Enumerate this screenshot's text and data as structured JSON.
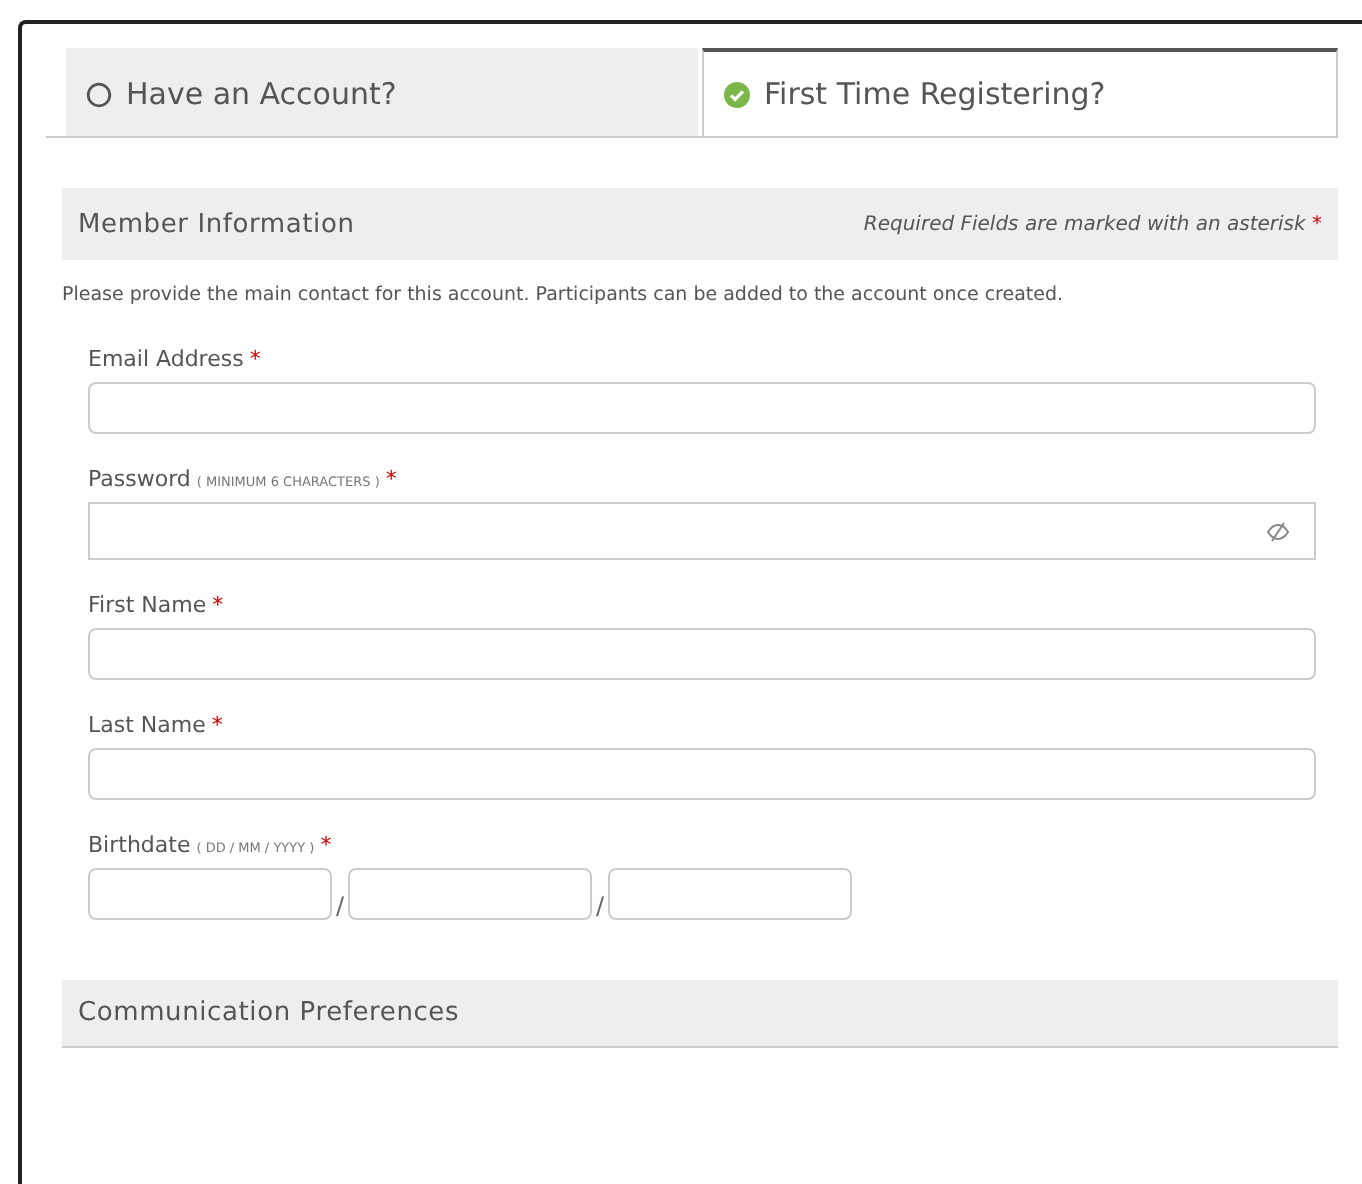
{
  "tabs": [
    {
      "label": "Have an Account?",
      "selected": false
    },
    {
      "label": "First Time Registering?",
      "selected": true
    }
  ],
  "member_section": {
    "title": "Member Information",
    "required_note": "Required Fields are marked with an asterisk",
    "required_mark": "*"
  },
  "intro": "Please provide the main contact for this account. Participants can be added to the account once created.",
  "fields": [
    {
      "kind": "text",
      "label": "Email Address",
      "required": true
    },
    {
      "kind": "password",
      "label": "Password",
      "hint": "( MINIMUM 6 CHARACTERS )",
      "required": true
    },
    {
      "kind": "text",
      "label": "First Name",
      "required": true
    },
    {
      "kind": "text",
      "label": "Last Name",
      "required": true
    },
    {
      "kind": "date",
      "label": "Birthdate",
      "hint": "( DD / MM / YYYY )",
      "required": true,
      "separators": [
        "/",
        "/"
      ]
    }
  ],
  "communication_section": {
    "title": "Communication Preferences"
  }
}
